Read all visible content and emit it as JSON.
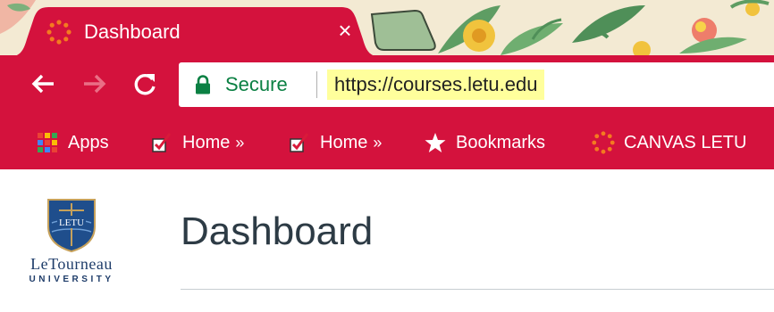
{
  "browser": {
    "tab": {
      "title": "Dashboard",
      "close_glyph": "×",
      "favicon": "canvas-ring-icon",
      "accent": "#d4123d"
    },
    "toolbar": {
      "back_icon": "arrow-left-icon",
      "forward_icon": "arrow-right-icon",
      "reload_icon": "reload-icon"
    },
    "address_bar": {
      "security_label": "Secure",
      "url": "https://courses.letu.edu",
      "secure_color": "#0b8043",
      "highlight_color": "#ffff9c"
    },
    "bookmarks": [
      {
        "label": "Apps",
        "icon": "apps-grid-icon"
      },
      {
        "label": "Home",
        "icon": "checkbox-icon",
        "folder_arrow": "»"
      },
      {
        "label": "Home",
        "icon": "checkbox-icon",
        "folder_arrow": "»"
      },
      {
        "label": "Bookmarks",
        "icon": "star-icon"
      },
      {
        "label": "CANVAS LETU",
        "icon": "canvas-ring-icon"
      }
    ]
  },
  "page": {
    "logo": {
      "shield_text": "LETU",
      "name": "LeTourneau",
      "subtitle": "UNIVERSITY"
    },
    "title": "Dashboard"
  }
}
